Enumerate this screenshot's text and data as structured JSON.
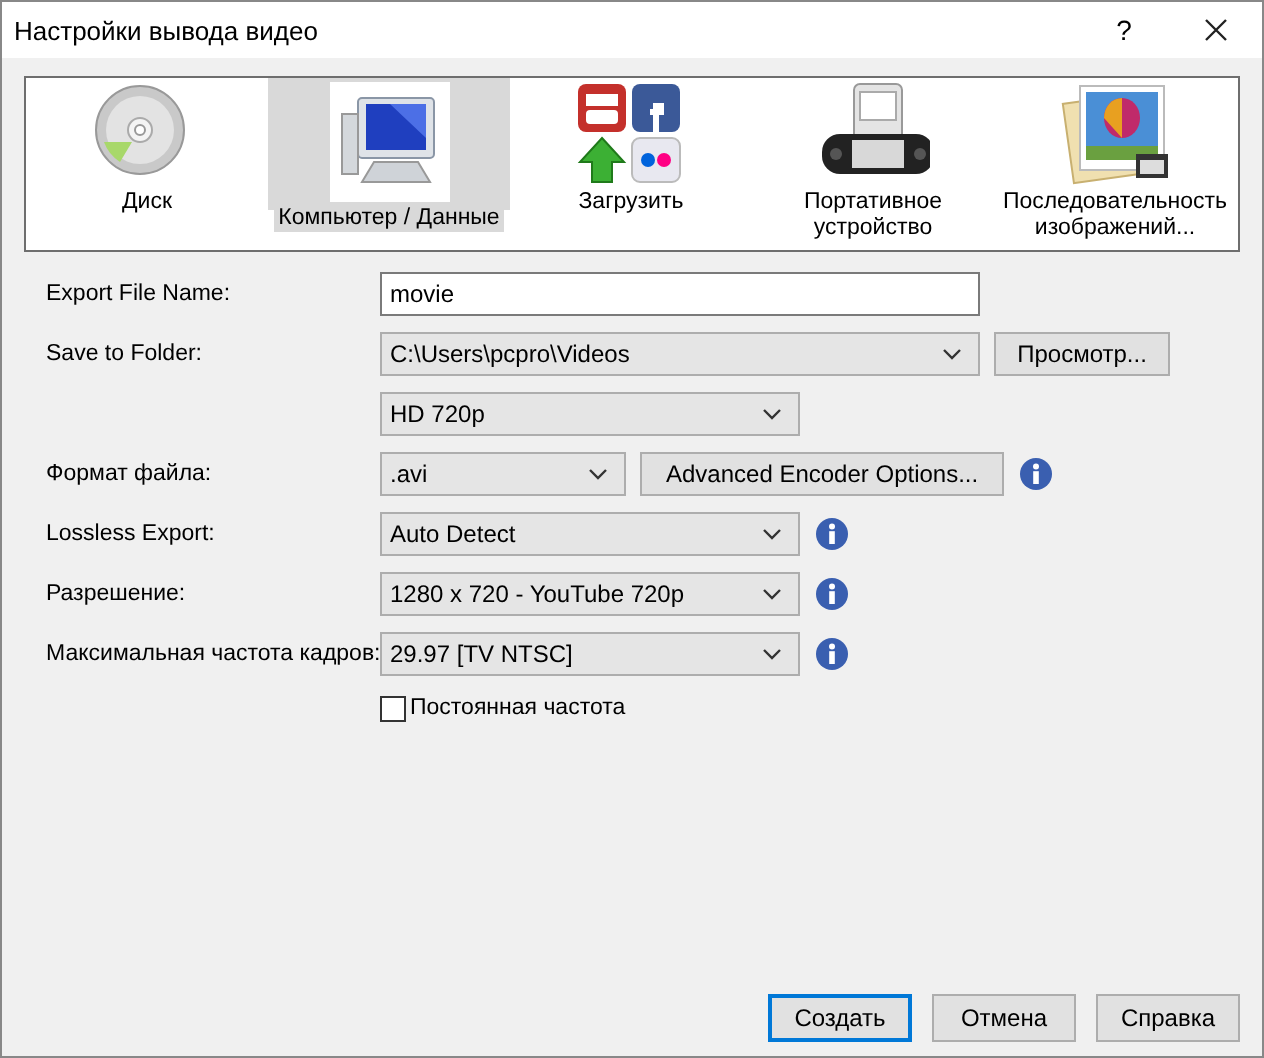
{
  "window": {
    "title": "Настройки вывода видео",
    "help": "?"
  },
  "categories": [
    {
      "label": "Диск",
      "kind": "disc",
      "selected": false
    },
    {
      "label": "Компьютер / Данные",
      "kind": "computer",
      "selected": true
    },
    {
      "label": "Загрузить",
      "kind": "upload",
      "selected": false
    },
    {
      "label": "Портативное устройство",
      "kind": "portable",
      "selected": false
    },
    {
      "label": "Последовательность изображений...",
      "kind": "images",
      "selected": false
    }
  ],
  "form": [
    {
      "kind": "text",
      "label": "Export File Name:",
      "value": "movie"
    },
    {
      "kind": "combo",
      "label": "Save to Folder:",
      "value": "C:\\Users\\pcpro\\Videos",
      "button": "Просмотр...",
      "info": false
    },
    {
      "kind": "combo",
      "value": "HD 720p",
      "info": false
    },
    {
      "kind": "combo",
      "label": "Формат файла:",
      "value": ".avi",
      "button": "Advanced Encoder Options...",
      "info": true
    },
    {
      "kind": "combo",
      "label": "Lossless Export:",
      "value": "Auto Detect",
      "info": true
    },
    {
      "kind": "combo",
      "label": "Разрешение:",
      "value": "1280 x 720 - YouTube 720p",
      "info": true
    },
    {
      "kind": "combo",
      "label": "Максимальная частота кадров:",
      "value": "29.97 [TV NTSC]",
      "info": true
    },
    {
      "kind": "checkbox",
      "label": "Постоянная частота",
      "checked": false
    }
  ],
  "buttons": [
    {
      "label": "Создать",
      "default": true
    },
    {
      "label": "Отмена",
      "default": false
    },
    {
      "label": "Справка",
      "default": false
    }
  ]
}
